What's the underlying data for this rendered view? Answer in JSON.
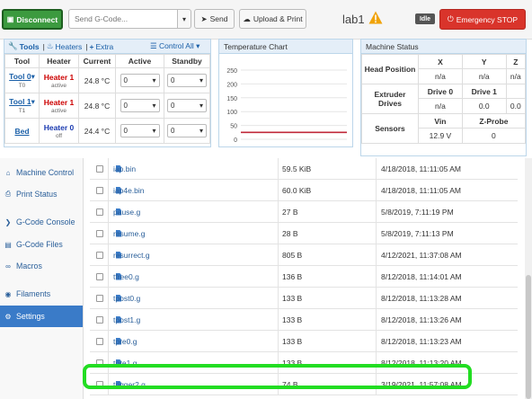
{
  "toolbar": {
    "disconnect_label": "Disconnect",
    "gcode_placeholder": "Send G-Code...",
    "send_label": "Send",
    "upload_label": "Upload & Print",
    "machine_name": "lab1",
    "status_badge": "Idle",
    "emergency_label": "Emergency STOP"
  },
  "tools_panel": {
    "header_tools": "Tools",
    "header_heaters": "Heaters",
    "header_extra": "Extra",
    "header_control_all": "Control All",
    "columns": [
      "Tool",
      "Heater",
      "Current",
      "Active",
      "Standby"
    ],
    "rows": [
      {
        "tool": "Tool 0",
        "tool_sub": "T0",
        "heater": "Heater 1",
        "heater_state": "active",
        "current": "24.8 °C",
        "active": "0",
        "standby": "0"
      },
      {
        "tool": "Tool 1",
        "tool_sub": "T1",
        "heater": "Heater 1",
        "heater_state": "active",
        "current": "24.8 °C",
        "active": "0",
        "standby": "0"
      },
      {
        "tool": "Bed",
        "tool_sub": "",
        "heater": "Heater 0",
        "heater_state": "off",
        "current": "24.4 °C",
        "active": "0",
        "standby": "0"
      }
    ]
  },
  "temperature_chart": {
    "title": "Temperature Chart",
    "chart_data": {
      "type": "line",
      "title": "Temperature Chart",
      "ylim": [
        0,
        250
      ],
      "y_ticks": [
        "250",
        "200",
        "150",
        "100",
        "50",
        "0"
      ],
      "series": [
        {
          "values": [
            24.8,
            24.8
          ]
        }
      ],
      "series_color": "#c0283a"
    }
  },
  "machine_status": {
    "title": "Machine Status",
    "axes_headers": [
      "X",
      "Y",
      "Z"
    ],
    "head_position_label": "Head Position",
    "head_position": [
      "n/a",
      "n/a",
      "n/a"
    ],
    "extruder_label": "Extruder Drives",
    "drive_headers": [
      "Drive 0",
      "Drive 1"
    ],
    "drive_values": [
      "n/a",
      "0.0",
      "0.0"
    ],
    "sensors_label": "Sensors",
    "sensor_headers": [
      "Vin",
      "Z-Probe"
    ],
    "sensor_values": [
      "12.9 V",
      "0"
    ]
  },
  "sidebar": {
    "items": [
      {
        "label": "Machine Control",
        "icon": "home-icon"
      },
      {
        "label": "Print Status",
        "icon": "print-icon"
      },
      {
        "label": "G-Code Console",
        "icon": "console-icon"
      },
      {
        "label": "G-Code Files",
        "icon": "files-icon"
      },
      {
        "label": "Macros",
        "icon": "macros-icon"
      },
      {
        "label": "Filaments",
        "icon": "filament-icon"
      },
      {
        "label": "Settings",
        "icon": "gear-icon"
      }
    ],
    "active": "Settings"
  },
  "files": [
    {
      "name": "iap.bin",
      "size": "59.5 KiB",
      "date": "4/18/2018, 11:11:05 AM"
    },
    {
      "name": "iap4e.bin",
      "size": "60.0 KiB",
      "date": "4/18/2018, 11:11:05 AM"
    },
    {
      "name": "pause.g",
      "size": "27 B",
      "date": "5/8/2019, 7:11:19 PM"
    },
    {
      "name": "resume.g",
      "size": "28 B",
      "date": "5/8/2019, 7:11:13 PM"
    },
    {
      "name": "resurrect.g",
      "size": "805 B",
      "date": "4/12/2021, 11:37:08 AM"
    },
    {
      "name": "tfree0.g",
      "size": "136 B",
      "date": "8/12/2018, 11:14:01 AM"
    },
    {
      "name": "tpost0.g",
      "size": "133 B",
      "date": "8/12/2018, 11:13:28 AM"
    },
    {
      "name": "tpost1.g",
      "size": "133 B",
      "date": "8/12/2018, 11:13:26 AM"
    },
    {
      "name": "tpre0.g",
      "size": "133 B",
      "date": "8/12/2018, 11:13:23 AM"
    },
    {
      "name": "tpre1.g",
      "size": "133 B",
      "date": "8/12/2018, 11:13:20 AM"
    },
    {
      "name": "trigger2.g",
      "size": "74 B",
      "date": "3/19/2021, 11:57:08 AM"
    }
  ],
  "colors": {
    "accent": "#3a7bc8",
    "danger": "#d9342b",
    "connect": "#3c9a3f",
    "highlight": "#22dd22"
  }
}
